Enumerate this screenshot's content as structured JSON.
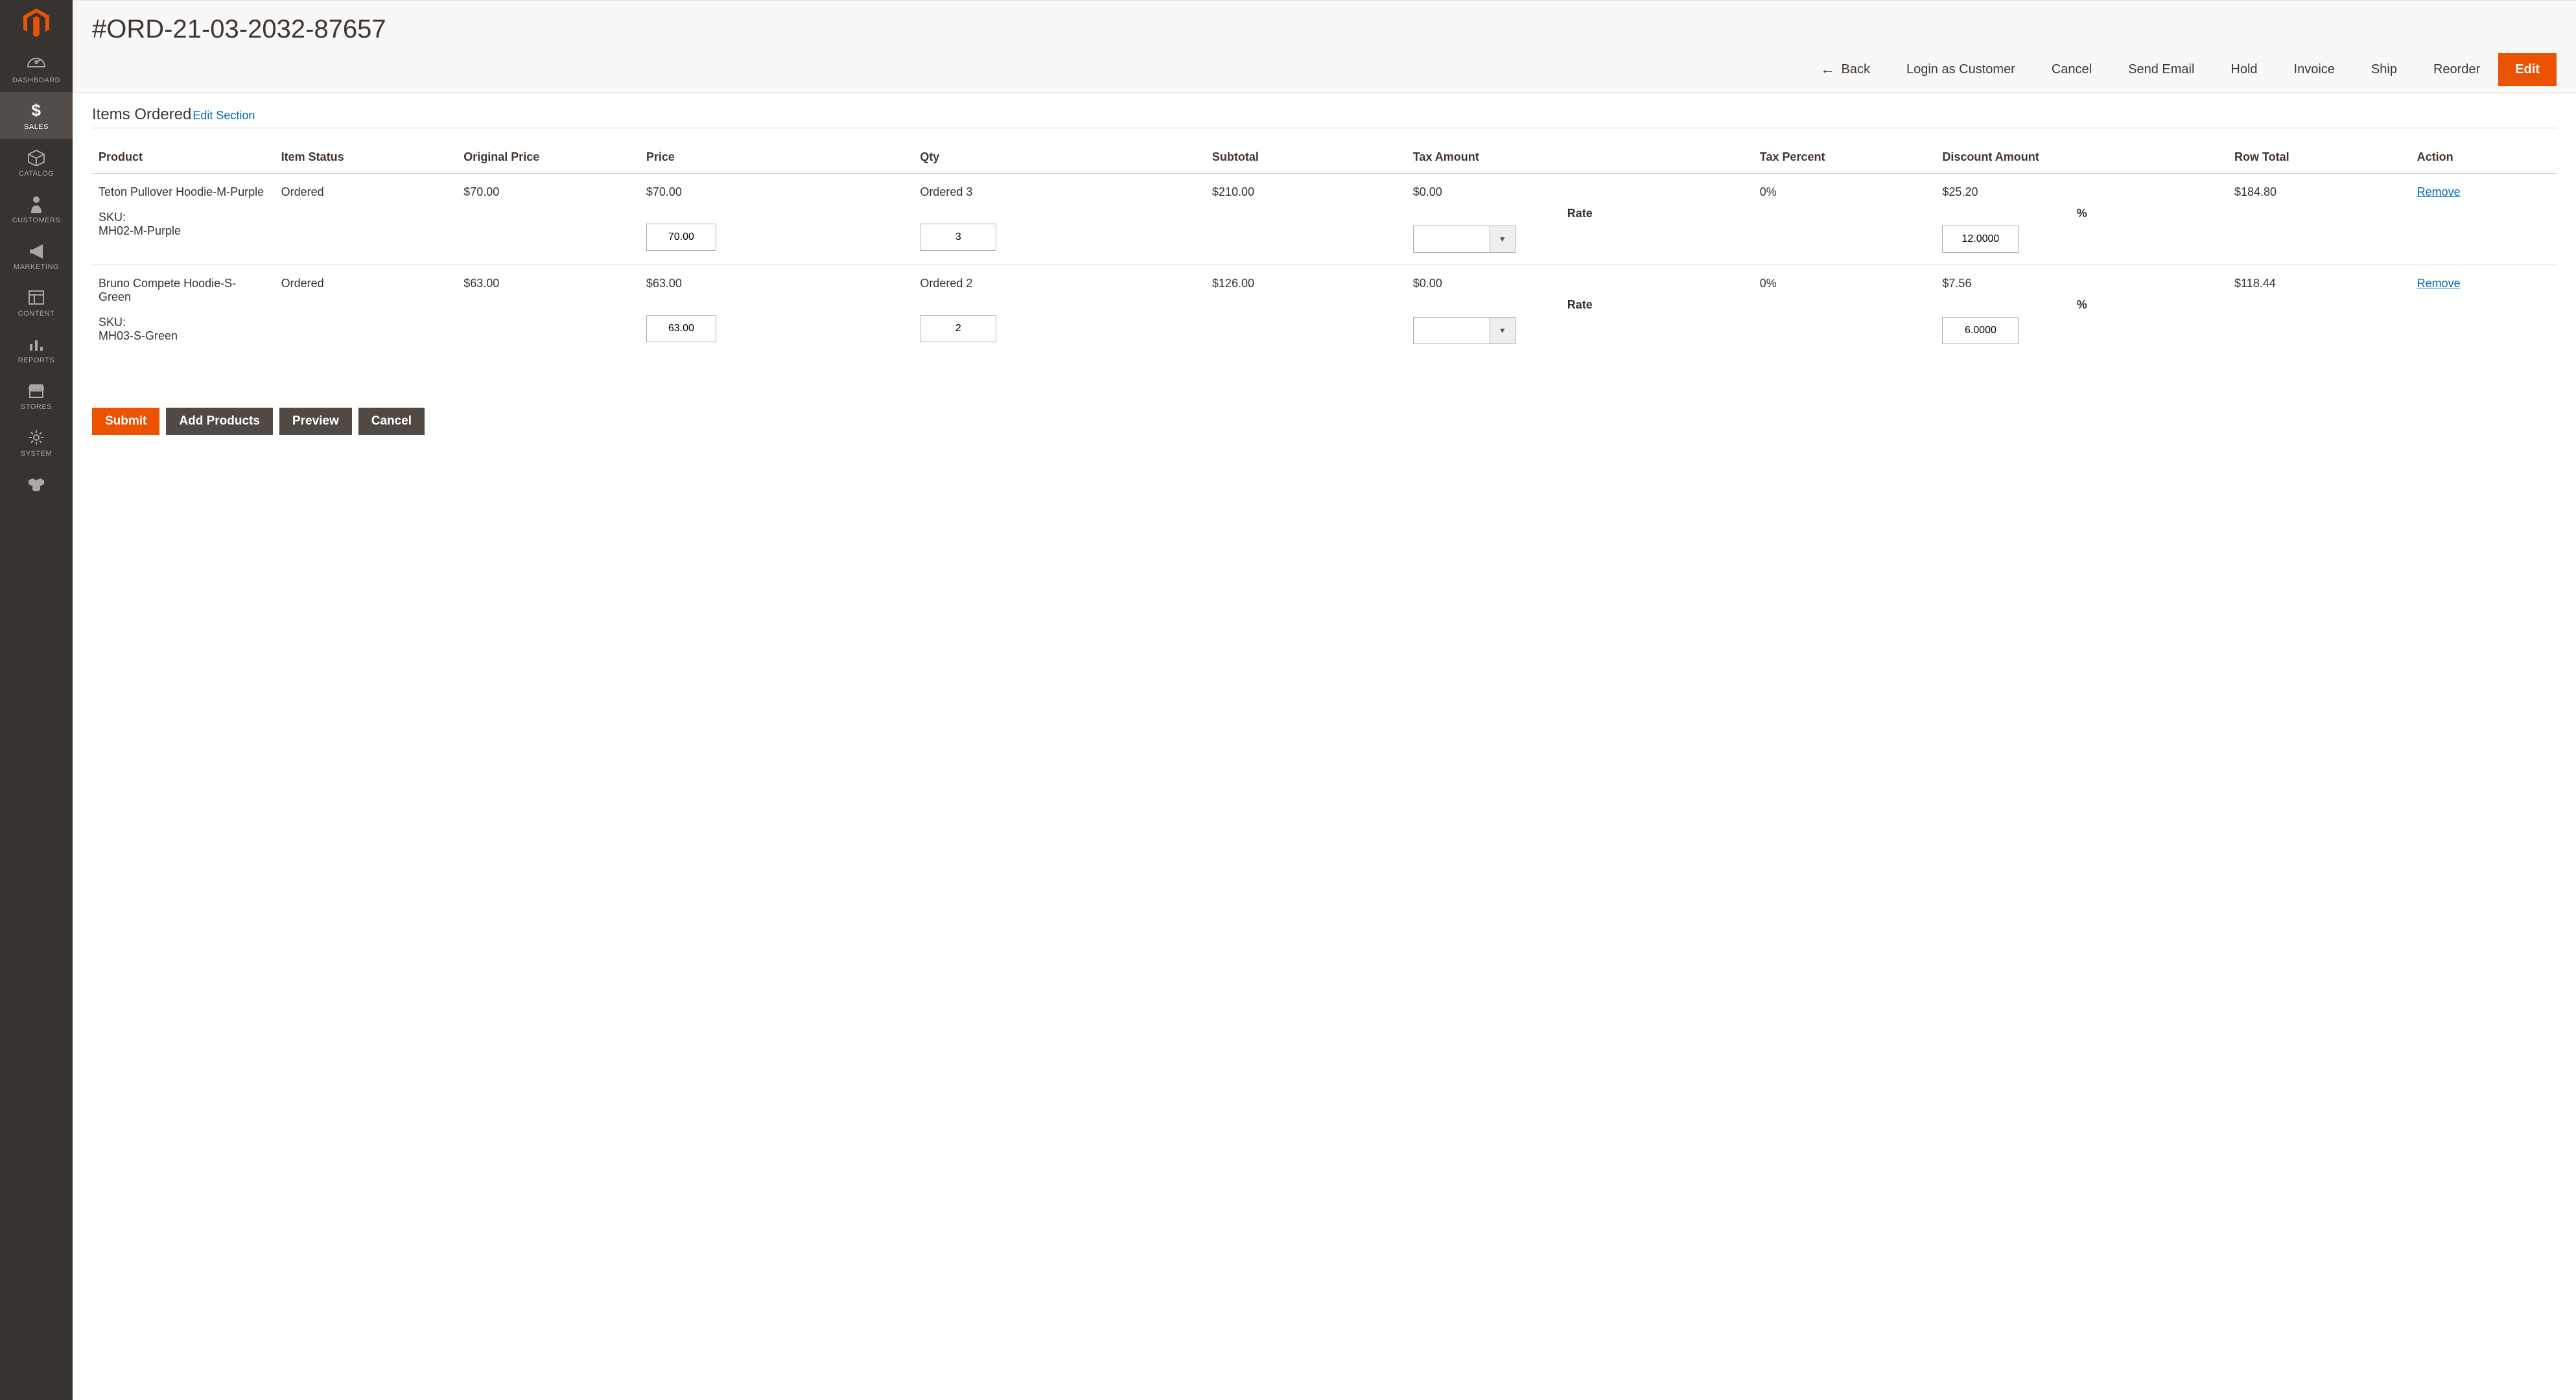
{
  "sidebar": {
    "items": [
      {
        "label": "DASHBOARD",
        "icon": "dashboard-icon"
      },
      {
        "label": "SALES",
        "icon": "dollar-icon",
        "active": true
      },
      {
        "label": "CATALOG",
        "icon": "box-icon"
      },
      {
        "label": "CUSTOMERS",
        "icon": "person-icon"
      },
      {
        "label": "MARKETING",
        "icon": "megaphone-icon"
      },
      {
        "label": "CONTENT",
        "icon": "layout-icon"
      },
      {
        "label": "REPORTS",
        "icon": "bars-icon"
      },
      {
        "label": "STORES",
        "icon": "storefront-icon"
      },
      {
        "label": "SYSTEM",
        "icon": "gear-icon"
      },
      {
        "label": "",
        "icon": "blocks-icon"
      }
    ]
  },
  "header": {
    "title": "#ORD-21-03-2032-87657",
    "buttons": {
      "back": "Back",
      "login_as_customer": "Login as Customer",
      "cancel": "Cancel",
      "send_email": "Send Email",
      "hold": "Hold",
      "invoice": "Invoice",
      "ship": "Ship",
      "reorder": "Reorder",
      "edit": "Edit"
    }
  },
  "section": {
    "title": "Items Ordered",
    "edit_link": "Edit Section"
  },
  "columns": {
    "product": "Product",
    "status": "Item Status",
    "original_price": "Original Price",
    "price": "Price",
    "qty": "Qty",
    "subtotal": "Subtotal",
    "tax_amount": "Tax Amount",
    "tax_percent": "Tax Percent",
    "discount_amount": "Discount Amount",
    "row_total": "Row Total",
    "action": "Action"
  },
  "labels": {
    "sku": "SKU:",
    "ordered": "Ordered",
    "rate": "Rate",
    "percent": "%",
    "remove": "Remove"
  },
  "rows": [
    {
      "name": "Teton Pullover Hoodie-M-Purple",
      "sku": "MH02-M-Purple",
      "status": "Ordered",
      "original_price": "$70.00",
      "price": "$70.00",
      "price_input": "70.00",
      "qty_text": "Ordered 3",
      "qty_input": "3",
      "subtotal": "$210.00",
      "tax_amount": "$0.00",
      "tax_rate": "",
      "tax_percent": "0%",
      "discount_amount": "$25.20",
      "discount_pct_input": "12.0000",
      "row_total": "$184.80"
    },
    {
      "name": "Bruno Compete Hoodie-S-Green",
      "sku": "MH03-S-Green",
      "status": "Ordered",
      "original_price": "$63.00",
      "price": "$63.00",
      "price_input": "63.00",
      "qty_text": "Ordered 2",
      "qty_input": "2",
      "subtotal": "$126.00",
      "tax_amount": "$0.00",
      "tax_rate": "",
      "tax_percent": "0%",
      "discount_amount": "$7.56",
      "discount_pct_input": "6.0000",
      "row_total": "$118.44"
    }
  ],
  "footer": {
    "submit": "Submit",
    "add_products": "Add Products",
    "preview": "Preview",
    "cancel": "Cancel"
  }
}
